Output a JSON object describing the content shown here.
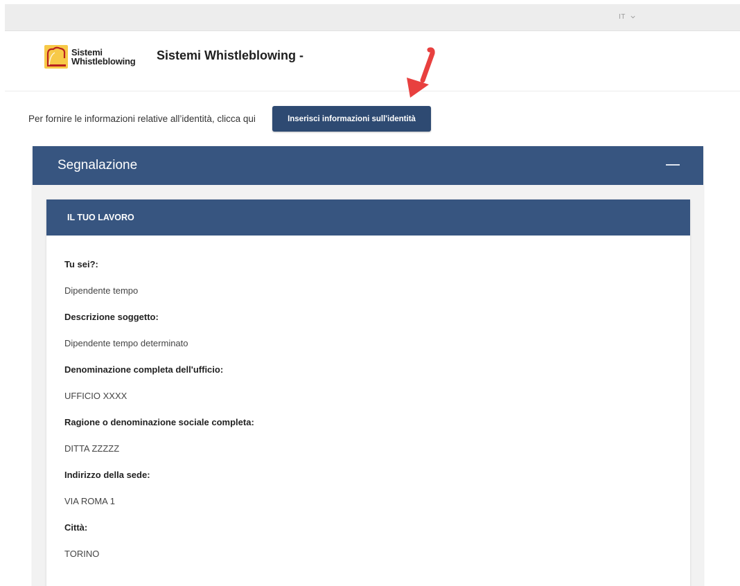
{
  "topbar": {
    "language": "IT",
    "language_icon": "chevron-down-icon"
  },
  "header": {
    "logo_line1": "Sistemi",
    "logo_line2": "Whistleblowing",
    "site_title": "Sistemi Whistleblowing -"
  },
  "identity": {
    "prompt": "Per fornire le informazioni relative all’identità, clicca qui",
    "button_label": "Inserisci informazioni sull'identità"
  },
  "panel": {
    "title": "Segnalazione",
    "collapse_icon": "minus-icon"
  },
  "section": {
    "title": "IL TUO LAVORO",
    "fields": [
      {
        "label": "Tu sei?:",
        "value": "Dipendente tempo"
      },
      {
        "label": "Descrizione soggetto:",
        "value": "Dipendente tempo determinato"
      },
      {
        "label": "Denominazione completa dell'ufficio:",
        "value": "UFFICIO XXXX"
      },
      {
        "label": "Ragione o denominazione sociale completa:",
        "value": "DITTA ZZZZZ"
      },
      {
        "label": "Indirizzo della sede:",
        "value": "VIA ROMA 1"
      },
      {
        "label": "Città:",
        "value": "TORINO"
      }
    ]
  },
  "colors": {
    "primary": "#375580",
    "button": "#2e4a72",
    "annotation_arrow": "#e8403f"
  }
}
